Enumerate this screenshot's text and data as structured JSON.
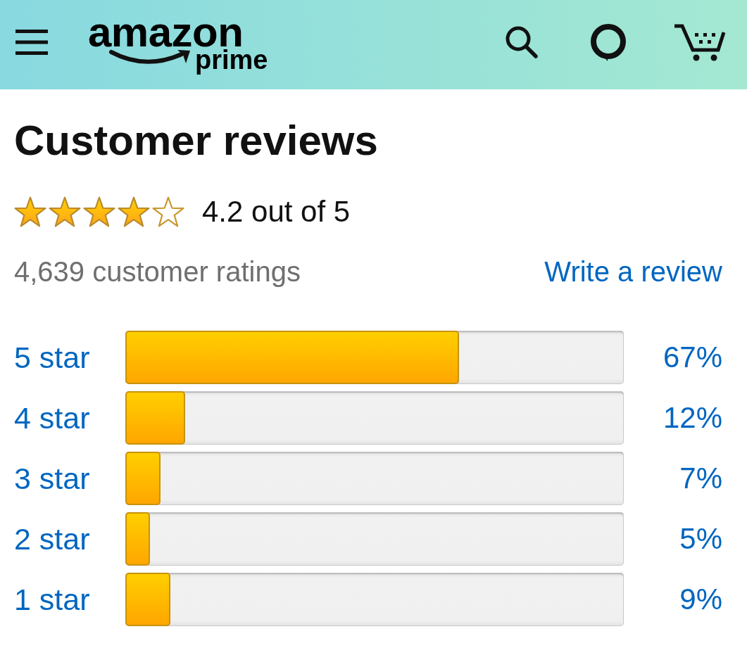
{
  "header": {
    "logo": {
      "word": "amazon",
      "tagline": "prime"
    }
  },
  "title": "Customer reviews",
  "rating": {
    "stars": 4,
    "summary": "4.2 out of 5"
  },
  "ratings_count": "4,639 customer ratings",
  "write_review_link": "Write a review",
  "histogram": [
    {
      "label": "5 star",
      "level": 0.67,
      "percent": "67%"
    },
    {
      "label": "4 star",
      "level": 0.12,
      "percent": "12%"
    },
    {
      "label": "3 star",
      "level": 0.07,
      "percent": "7%"
    },
    {
      "label": "2 star",
      "level": 0.05,
      "percent": "5%"
    },
    {
      "label": "1 star",
      "level": 0.09,
      "percent": "9%"
    }
  ]
}
